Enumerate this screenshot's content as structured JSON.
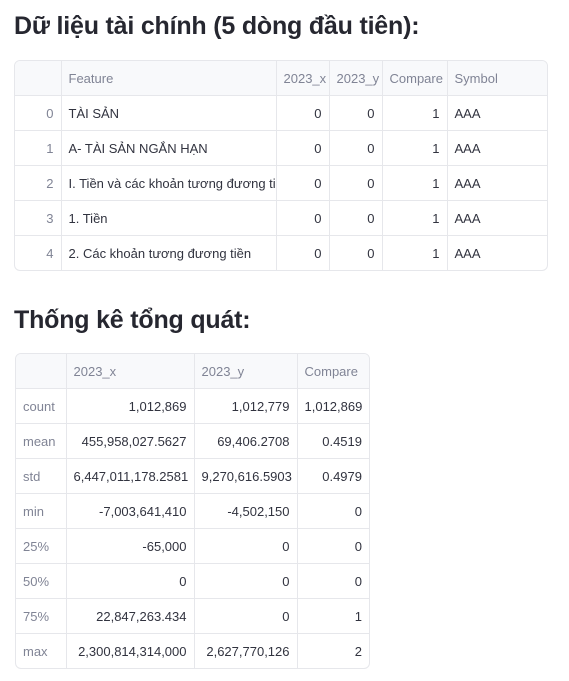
{
  "preview": {
    "title": "Dữ liệu tài chính (5 dòng đầu tiên):",
    "columns": [
      "",
      "Feature",
      "2023_x",
      "2023_y",
      "Compare",
      "Symbol"
    ],
    "rows": [
      {
        "index": "0",
        "feature": "TÀI SẢN",
        "x": "0",
        "y": "0",
        "compare": "1",
        "symbol": "AAA"
      },
      {
        "index": "1",
        "feature": "A- TÀI SẢN NGẮN HẠN",
        "x": "0",
        "y": "0",
        "compare": "1",
        "symbol": "AAA"
      },
      {
        "index": "2",
        "feature": "I. Tiền và các khoản tương đương tiền",
        "x": "0",
        "y": "0",
        "compare": "1",
        "symbol": "AAA"
      },
      {
        "index": "3",
        "feature": "1. Tiền",
        "x": "0",
        "y": "0",
        "compare": "1",
        "symbol": "AAA"
      },
      {
        "index": "4",
        "feature": "2. Các khoản tương đương tiền",
        "x": "0",
        "y": "0",
        "compare": "1",
        "symbol": "AAA"
      }
    ]
  },
  "stats": {
    "title": "Thống kê tổng quát:",
    "columns": [
      "",
      "2023_x",
      "2023_y",
      "Compare"
    ],
    "rows": [
      {
        "stat": "count",
        "x": "1,012,869",
        "y": "1,012,779",
        "compare": "1,012,869"
      },
      {
        "stat": "mean",
        "x": "455,958,027.5627",
        "y": "69,406.2708",
        "compare": "0.4519"
      },
      {
        "stat": "std",
        "x": "6,447,011,178.2581",
        "y": "9,270,616.5903",
        "compare": "0.4979"
      },
      {
        "stat": "min",
        "x": "-7,003,641,410",
        "y": "-4,502,150",
        "compare": "0"
      },
      {
        "stat": "25%",
        "x": "-65,000",
        "y": "0",
        "compare": "0"
      },
      {
        "stat": "50%",
        "x": "0",
        "y": "0",
        "compare": "0"
      },
      {
        "stat": "75%",
        "x": "22,847,263.434",
        "y": "0",
        "compare": "1"
      },
      {
        "stat": "max",
        "x": "2,300,814,314,000",
        "y": "2,627,770,126",
        "compare": "2"
      }
    ]
  }
}
